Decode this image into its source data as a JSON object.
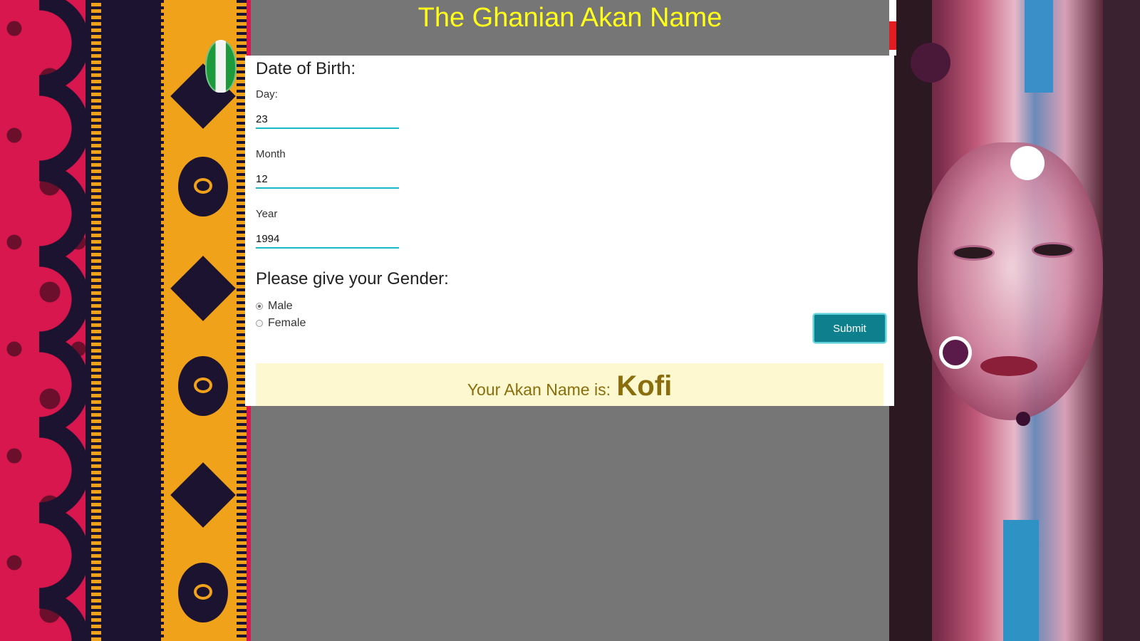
{
  "header": {
    "title": "The Ghanian Akan Name"
  },
  "form": {
    "dob_heading": "Date of Birth:",
    "day": {
      "label": "Day:",
      "value": "23"
    },
    "month": {
      "label": "Month",
      "value": "12"
    },
    "year": {
      "label": "Year",
      "value": "1994"
    },
    "gender_heading": "Please give your Gender:",
    "gender_options": [
      {
        "label": "Male",
        "checked": true
      },
      {
        "label": "Female",
        "checked": false
      }
    ],
    "submit_label": "Submit"
  },
  "result": {
    "prefix": "Your Akan Name is:",
    "name": "Kofi"
  },
  "colors": {
    "title": "#ffff1a",
    "accent": "#0e7f8c",
    "input_underline": "#1ab8c4",
    "result_bg": "#fdf8cf",
    "result_text": "#8a6d0d",
    "page_bg": "#767676"
  }
}
